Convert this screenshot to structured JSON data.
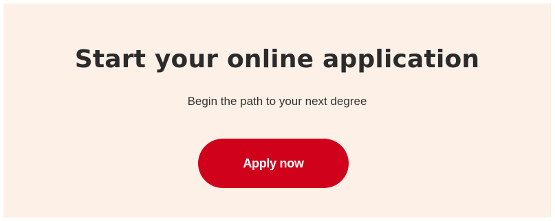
{
  "cta": {
    "title": "Start your online application",
    "subtitle": "Begin the path to your next degree",
    "button_label": "Apply now"
  },
  "colors": {
    "panel_background": "#fdf0e7",
    "button_background": "#d0021b",
    "button_text": "#ffffff",
    "title_text": "#2b2b2b"
  }
}
